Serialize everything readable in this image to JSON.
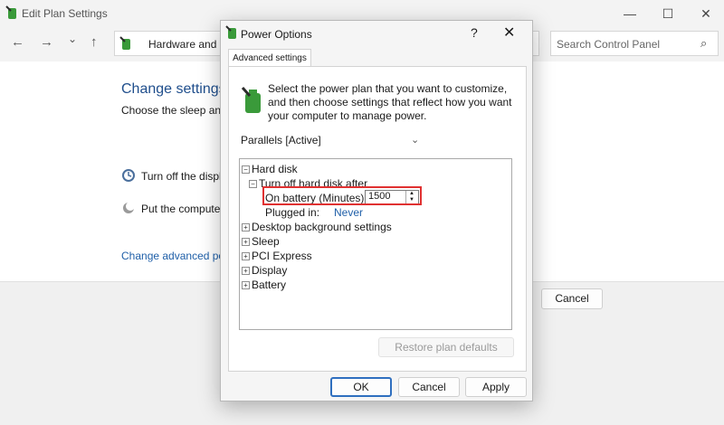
{
  "background_window": {
    "title": "Edit Plan Settings",
    "controls": {
      "minimize": "—",
      "maximize": "☐",
      "close": "✕"
    },
    "nav": {
      "back": "←",
      "forward": "→",
      "recent": "⌄",
      "up": "↑"
    },
    "address_text": "Hardware and So",
    "search_placeholder": "Search Control Panel",
    "heading": "Change settings",
    "subtext": "Choose the sleep and",
    "rows": [
      {
        "label": "Turn off the displa"
      },
      {
        "label": "Put the computer"
      }
    ],
    "advanced_link": "Change advanced pow",
    "cancel_label": "Cancel"
  },
  "dialog": {
    "title": "Power Options",
    "help": "?",
    "close": "✕",
    "tab": "Advanced settings",
    "intro": "Select the power plan that you want to customize, and then choose settings that reflect how you want your computer to manage power.",
    "plan_selected": "Parallels [Active]",
    "tree": {
      "hard_disk": "Hard disk",
      "turn_off": "Turn off hard disk after",
      "on_battery_label": "On battery (Minutes):",
      "on_battery_value": "1500",
      "plugged_label": "Plugged in:",
      "plugged_value": "Never",
      "items": [
        "Desktop background settings",
        "Sleep",
        "PCI Express",
        "Display",
        "Battery"
      ]
    },
    "restore_label": "Restore plan defaults",
    "ok_label": "OK",
    "cancel_label": "Cancel",
    "apply_label": "Apply"
  },
  "colors": {
    "accent_link": "#1f5fa8",
    "highlight": "#e03131"
  }
}
